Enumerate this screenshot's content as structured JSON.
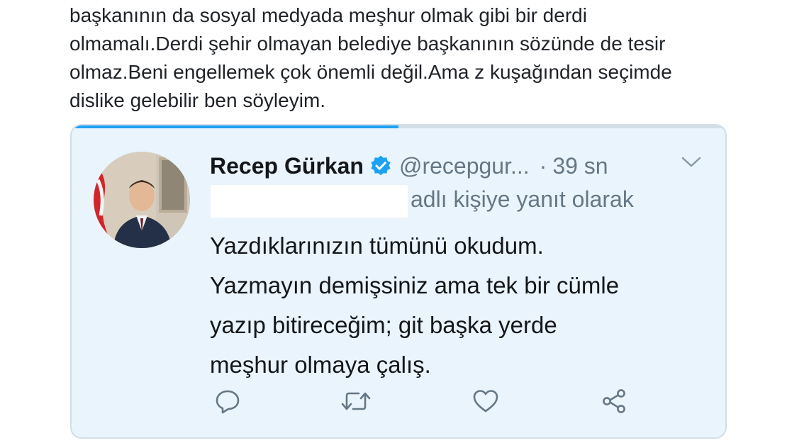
{
  "parent_tweet": {
    "lines": [
      "başkanının da sosyal medyada meşhur olmak gibi bir derdi",
      "olmamalı.Derdi şehir olmayan belediye başkanının sözünde de tesir",
      "olmaz.Beni engellemek çok önemli değil.Ama z kuşağından seçimde",
      "dislike gelebilir ben söyleyim."
    ]
  },
  "reply_tweet": {
    "load_progress": 0.5,
    "author_name": "Recep Gürkan",
    "verified_icon": "verified-badge-icon",
    "handle": "@recepgur...",
    "separator": "·",
    "time": "39 sn",
    "menu_icon": "chevron-down-icon",
    "reply_context": "adlı kişiye yanıt olarak",
    "body_lines": [
      "Yazdıklarınızın tümünü okudum.",
      "Yazmayın demişsiniz ama tek bir cümle",
      "yazıp bitireceğim; git başka yerde",
      "meşhur olmaya çalış."
    ],
    "actions": [
      {
        "name": "reply",
        "icon": "comment-icon"
      },
      {
        "name": "retweet",
        "icon": "retweet-icon"
      },
      {
        "name": "like",
        "icon": "heart-icon"
      },
      {
        "name": "share",
        "icon": "share-icon"
      }
    ]
  },
  "colors": {
    "card_background": "#eaf4fc",
    "accent": "#1da1f2",
    "secondary_text": "#657786",
    "primary_text": "#14171a"
  }
}
